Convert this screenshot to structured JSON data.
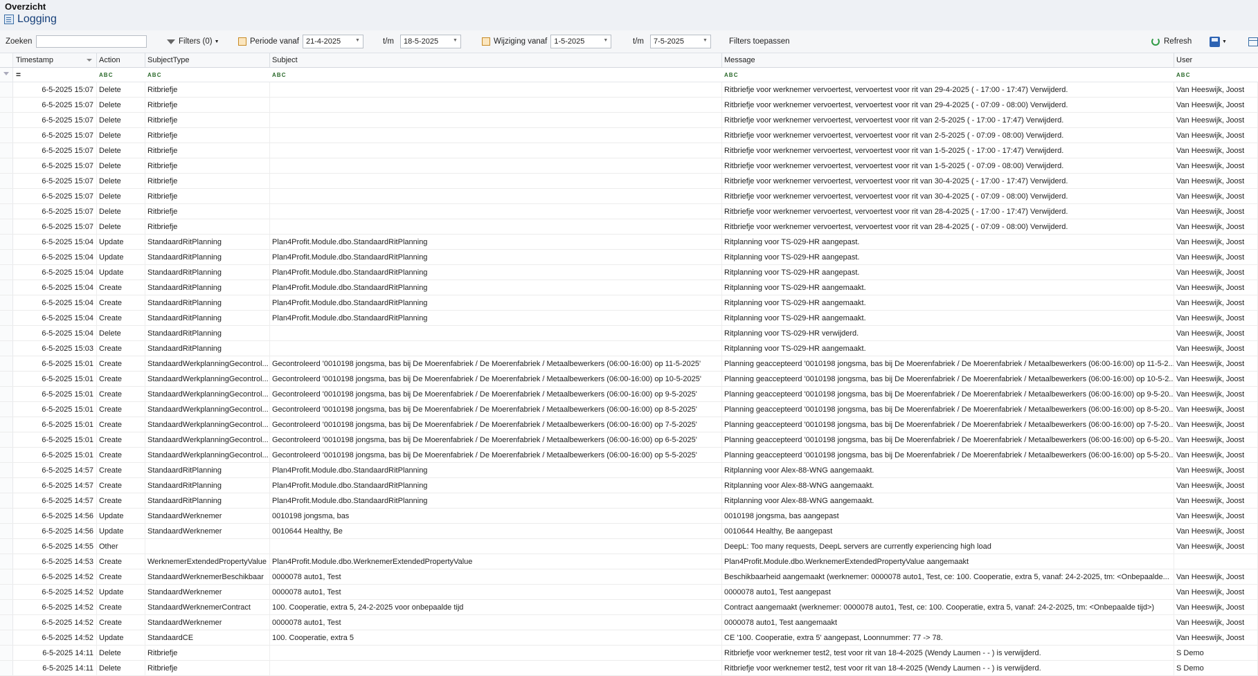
{
  "header": {
    "breadcrumb": "Overzicht",
    "title": "Logging"
  },
  "toolbar": {
    "search_label": "Zoeken",
    "search_value": "",
    "filters_label": "Filters (0)",
    "periode_label": "Periode vanaf",
    "periode_from": "21-4-2025",
    "tm_label": "t/m",
    "periode_to": "18-5-2025",
    "wijziging_label": "Wijziging vanaf",
    "wijziging_from": "1-5-2025",
    "wijziging_to": "7-5-2025",
    "apply_label": "Filters toepassen",
    "refresh_label": "Refresh"
  },
  "columns": [
    "Timestamp",
    "Action",
    "SubjectType",
    "Subject",
    "Message",
    "User"
  ],
  "filter_row": {
    "abc": "A B C",
    "equals": "="
  },
  "rows": [
    {
      "ts": "6-5-2025 15:07",
      "action": "Delete",
      "type": "Ritbriefje",
      "subject": "",
      "message": "Ritbriefje voor werknemer vervoertest, vervoertest voor rit van 29-4-2025 ( - 17:00 - 17:47) Verwijderd.",
      "user": "Van Heeswijk, Joost"
    },
    {
      "ts": "6-5-2025 15:07",
      "action": "Delete",
      "type": "Ritbriefje",
      "subject": "",
      "message": "Ritbriefje voor werknemer vervoertest, vervoertest voor rit van 29-4-2025 ( - 07:09 - 08:00) Verwijderd.",
      "user": "Van Heeswijk, Joost"
    },
    {
      "ts": "6-5-2025 15:07",
      "action": "Delete",
      "type": "Ritbriefje",
      "subject": "",
      "message": "Ritbriefje voor werknemer vervoertest, vervoertest voor rit van 2-5-2025 ( - 17:00 - 17:47) Verwijderd.",
      "user": "Van Heeswijk, Joost"
    },
    {
      "ts": "6-5-2025 15:07",
      "action": "Delete",
      "type": "Ritbriefje",
      "subject": "",
      "message": "Ritbriefje voor werknemer vervoertest, vervoertest voor rit van 2-5-2025 ( - 07:09 - 08:00) Verwijderd.",
      "user": "Van Heeswijk, Joost"
    },
    {
      "ts": "6-5-2025 15:07",
      "action": "Delete",
      "type": "Ritbriefje",
      "subject": "",
      "message": "Ritbriefje voor werknemer vervoertest, vervoertest voor rit van 1-5-2025 ( - 17:00 - 17:47) Verwijderd.",
      "user": "Van Heeswijk, Joost"
    },
    {
      "ts": "6-5-2025 15:07",
      "action": "Delete",
      "type": "Ritbriefje",
      "subject": "",
      "message": "Ritbriefje voor werknemer vervoertest, vervoertest voor rit van 1-5-2025 ( - 07:09 - 08:00) Verwijderd.",
      "user": "Van Heeswijk, Joost"
    },
    {
      "ts": "6-5-2025 15:07",
      "action": "Delete",
      "type": "Ritbriefje",
      "subject": "",
      "message": "Ritbriefje voor werknemer vervoertest, vervoertest voor rit van 30-4-2025 ( - 17:00 - 17:47) Verwijderd.",
      "user": "Van Heeswijk, Joost"
    },
    {
      "ts": "6-5-2025 15:07",
      "action": "Delete",
      "type": "Ritbriefje",
      "subject": "",
      "message": "Ritbriefje voor werknemer vervoertest, vervoertest voor rit van 30-4-2025 ( - 07:09 - 08:00) Verwijderd.",
      "user": "Van Heeswijk, Joost"
    },
    {
      "ts": "6-5-2025 15:07",
      "action": "Delete",
      "type": "Ritbriefje",
      "subject": "",
      "message": "Ritbriefje voor werknemer vervoertest, vervoertest voor rit van 28-4-2025 ( - 17:00 - 17:47) Verwijderd.",
      "user": "Van Heeswijk, Joost"
    },
    {
      "ts": "6-5-2025 15:07",
      "action": "Delete",
      "type": "Ritbriefje",
      "subject": "",
      "message": "Ritbriefje voor werknemer vervoertest, vervoertest voor rit van 28-4-2025 ( - 07:09 - 08:00) Verwijderd.",
      "user": "Van Heeswijk, Joost"
    },
    {
      "ts": "6-5-2025 15:04",
      "action": "Update",
      "type": "StandaardRitPlanning",
      "subject": "Plan4Profit.Module.dbo.StandaardRitPlanning",
      "message": "Ritplanning voor TS-029-HR aangepast.",
      "user": "Van Heeswijk, Joost"
    },
    {
      "ts": "6-5-2025 15:04",
      "action": "Update",
      "type": "StandaardRitPlanning",
      "subject": "Plan4Profit.Module.dbo.StandaardRitPlanning",
      "message": "Ritplanning voor TS-029-HR aangepast.",
      "user": "Van Heeswijk, Joost"
    },
    {
      "ts": "6-5-2025 15:04",
      "action": "Update",
      "type": "StandaardRitPlanning",
      "subject": "Plan4Profit.Module.dbo.StandaardRitPlanning",
      "message": "Ritplanning voor TS-029-HR aangepast.",
      "user": "Van Heeswijk, Joost"
    },
    {
      "ts": "6-5-2025 15:04",
      "action": "Create",
      "type": "StandaardRitPlanning",
      "subject": "Plan4Profit.Module.dbo.StandaardRitPlanning",
      "message": "Ritplanning voor TS-029-HR aangemaakt.",
      "user": "Van Heeswijk, Joost"
    },
    {
      "ts": "6-5-2025 15:04",
      "action": "Create",
      "type": "StandaardRitPlanning",
      "subject": "Plan4Profit.Module.dbo.StandaardRitPlanning",
      "message": "Ritplanning voor TS-029-HR aangemaakt.",
      "user": "Van Heeswijk, Joost"
    },
    {
      "ts": "6-5-2025 15:04",
      "action": "Create",
      "type": "StandaardRitPlanning",
      "subject": "Plan4Profit.Module.dbo.StandaardRitPlanning",
      "message": "Ritplanning voor TS-029-HR aangemaakt.",
      "user": "Van Heeswijk, Joost"
    },
    {
      "ts": "6-5-2025 15:04",
      "action": "Delete",
      "type": "StandaardRitPlanning",
      "subject": "",
      "message": "Ritplanning voor TS-029-HR verwijderd.",
      "user": "Van Heeswijk, Joost"
    },
    {
      "ts": "6-5-2025 15:03",
      "action": "Create",
      "type": "StandaardRitPlanning",
      "subject": "",
      "message": "Ritplanning voor TS-029-HR aangemaakt.",
      "user": "Van Heeswijk, Joost"
    },
    {
      "ts": "6-5-2025 15:01",
      "action": "Create",
      "type": "StandaardWerkplanningGecontrol...",
      "subject": "Gecontroleerd '0010198 jongsma, bas bij De Moerenfabriek / De Moerenfabriek / Metaalbewerkers (06:00-16:00) op 11-5-2025'",
      "message": "Planning geaccepteerd '0010198 jongsma, bas bij De Moerenfabriek / De Moerenfabriek / Metaalbewerkers (06:00-16:00) op 11-5-2...",
      "user": "Van Heeswijk, Joost"
    },
    {
      "ts": "6-5-2025 15:01",
      "action": "Create",
      "type": "StandaardWerkplanningGecontrol...",
      "subject": "Gecontroleerd '0010198 jongsma, bas bij De Moerenfabriek / De Moerenfabriek / Metaalbewerkers (06:00-16:00) op 10-5-2025'",
      "message": "Planning geaccepteerd '0010198 jongsma, bas bij De Moerenfabriek / De Moerenfabriek / Metaalbewerkers (06:00-16:00) op 10-5-2...",
      "user": "Van Heeswijk, Joost"
    },
    {
      "ts": "6-5-2025 15:01",
      "action": "Create",
      "type": "StandaardWerkplanningGecontrol...",
      "subject": "Gecontroleerd '0010198 jongsma, bas bij De Moerenfabriek / De Moerenfabriek / Metaalbewerkers (06:00-16:00) op 9-5-2025'",
      "message": "Planning geaccepteerd '0010198 jongsma, bas bij De Moerenfabriek / De Moerenfabriek / Metaalbewerkers (06:00-16:00) op 9-5-20...",
      "user": "Van Heeswijk, Joost"
    },
    {
      "ts": "6-5-2025 15:01",
      "action": "Create",
      "type": "StandaardWerkplanningGecontrol...",
      "subject": "Gecontroleerd '0010198 jongsma, bas bij De Moerenfabriek / De Moerenfabriek / Metaalbewerkers (06:00-16:00) op 8-5-2025'",
      "message": "Planning geaccepteerd '0010198 jongsma, bas bij De Moerenfabriek / De Moerenfabriek / Metaalbewerkers (06:00-16:00) op 8-5-20...",
      "user": "Van Heeswijk, Joost"
    },
    {
      "ts": "6-5-2025 15:01",
      "action": "Create",
      "type": "StandaardWerkplanningGecontrol...",
      "subject": "Gecontroleerd '0010198 jongsma, bas bij De Moerenfabriek / De Moerenfabriek / Metaalbewerkers (06:00-16:00) op 7-5-2025'",
      "message": "Planning geaccepteerd '0010198 jongsma, bas bij De Moerenfabriek / De Moerenfabriek / Metaalbewerkers (06:00-16:00) op 7-5-20...",
      "user": "Van Heeswijk, Joost"
    },
    {
      "ts": "6-5-2025 15:01",
      "action": "Create",
      "type": "StandaardWerkplanningGecontrol...",
      "subject": "Gecontroleerd '0010198 jongsma, bas bij De Moerenfabriek / De Moerenfabriek / Metaalbewerkers (06:00-16:00) op 6-5-2025'",
      "message": "Planning geaccepteerd '0010198 jongsma, bas bij De Moerenfabriek / De Moerenfabriek / Metaalbewerkers (06:00-16:00) op 6-5-20...",
      "user": "Van Heeswijk, Joost"
    },
    {
      "ts": "6-5-2025 15:01",
      "action": "Create",
      "type": "StandaardWerkplanningGecontrol...",
      "subject": "Gecontroleerd '0010198 jongsma, bas bij De Moerenfabriek / De Moerenfabriek / Metaalbewerkers (06:00-16:00) op 5-5-2025'",
      "message": "Planning geaccepteerd '0010198 jongsma, bas bij De Moerenfabriek / De Moerenfabriek / Metaalbewerkers (06:00-16:00) op 5-5-20...",
      "user": "Van Heeswijk, Joost"
    },
    {
      "ts": "6-5-2025 14:57",
      "action": "Create",
      "type": "StandaardRitPlanning",
      "subject": "Plan4Profit.Module.dbo.StandaardRitPlanning",
      "message": "Ritplanning voor Alex-88-WNG aangemaakt.",
      "user": "Van Heeswijk, Joost"
    },
    {
      "ts": "6-5-2025 14:57",
      "action": "Create",
      "type": "StandaardRitPlanning",
      "subject": "Plan4Profit.Module.dbo.StandaardRitPlanning",
      "message": "Ritplanning voor Alex-88-WNG aangemaakt.",
      "user": "Van Heeswijk, Joost"
    },
    {
      "ts": "6-5-2025 14:57",
      "action": "Create",
      "type": "StandaardRitPlanning",
      "subject": "Plan4Profit.Module.dbo.StandaardRitPlanning",
      "message": "Ritplanning voor Alex-88-WNG aangemaakt.",
      "user": "Van Heeswijk, Joost"
    },
    {
      "ts": "6-5-2025 14:56",
      "action": "Update",
      "type": "StandaardWerknemer",
      "subject": "0010198 jongsma, bas",
      "message": "0010198 jongsma, bas aangepast",
      "user": "Van Heeswijk, Joost"
    },
    {
      "ts": "6-5-2025 14:56",
      "action": "Update",
      "type": "StandaardWerknemer",
      "subject": "0010644 Healthy, Be",
      "message": "0010644 Healthy, Be aangepast",
      "user": "Van Heeswijk, Joost"
    },
    {
      "ts": "6-5-2025 14:55",
      "action": "Other",
      "type": "",
      "subject": "",
      "message": "DeepL: Too many requests, DeepL servers are currently experiencing high load",
      "user": "Van Heeswijk, Joost"
    },
    {
      "ts": "6-5-2025 14:53",
      "action": "Create",
      "type": "WerknemerExtendedPropertyValue",
      "subject": "Plan4Profit.Module.dbo.WerknemerExtendedPropertyValue",
      "message": "Plan4Profit.Module.dbo.WerknemerExtendedPropertyValue aangemaakt",
      "user": ""
    },
    {
      "ts": "6-5-2025 14:52",
      "action": "Create",
      "type": "StandaardWerknemerBeschikbaar",
      "subject": "0000078 auto1, Test",
      "message": "Beschikbaarheid aangemaakt (werknemer: 0000078 auto1, Test, ce: 100. Cooperatie, extra 5, vanaf: 24-2-2025, tm: <Onbepaalde...",
      "user": "Van Heeswijk, Joost"
    },
    {
      "ts": "6-5-2025 14:52",
      "action": "Update",
      "type": "StandaardWerknemer",
      "subject": "0000078 auto1, Test",
      "message": "0000078 auto1, Test aangepast",
      "user": "Van Heeswijk, Joost"
    },
    {
      "ts": "6-5-2025 14:52",
      "action": "Create",
      "type": "StandaardWerknemerContract",
      "subject": "100. Cooperatie, extra 5, 24-2-2025 voor onbepaalde tijd",
      "message": "Contract aangemaakt (werknemer: 0000078 auto1, Test, ce: 100. Cooperatie, extra 5, vanaf: 24-2-2025, tm: <Onbepaalde tijd>)",
      "user": "Van Heeswijk, Joost"
    },
    {
      "ts": "6-5-2025 14:52",
      "action": "Create",
      "type": "StandaardWerknemer",
      "subject": "0000078 auto1, Test",
      "message": "0000078 auto1, Test aangemaakt",
      "user": "Van Heeswijk, Joost"
    },
    {
      "ts": "6-5-2025 14:52",
      "action": "Update",
      "type": "StandaardCE",
      "subject": "100. Cooperatie, extra 5",
      "message": "CE '100. Cooperatie, extra 5' aangepast, Loonnummer: 77 -> 78.",
      "user": "Van Heeswijk, Joost"
    },
    {
      "ts": "6-5-2025 14:11",
      "action": "Delete",
      "type": "Ritbriefje",
      "subject": "",
      "message": "Ritbriefje voor werknemer test2, test voor rit van 18-4-2025 (Wendy Laumen -  - ) is verwijderd.",
      "user": "S Demo"
    },
    {
      "ts": "6-5-2025 14:11",
      "action": "Delete",
      "type": "Ritbriefje",
      "subject": "",
      "message": "Ritbriefje voor werknemer test2, test voor rit van 18-4-2025 (Wendy Laumen -  - ) is verwijderd.",
      "user": "S Demo"
    }
  ]
}
